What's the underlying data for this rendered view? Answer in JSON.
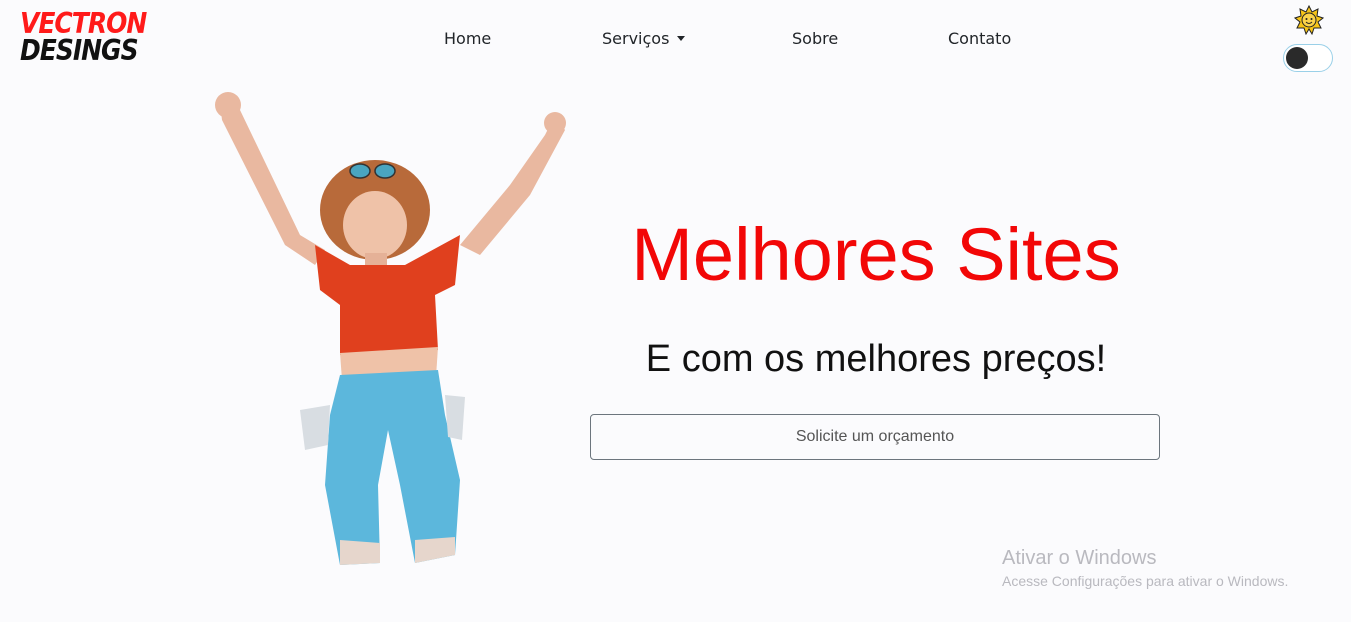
{
  "logo": {
    "line1": "VECTRON",
    "line2": "DESINGS"
  },
  "nav": {
    "home": "Home",
    "services": "Serviços",
    "about": "Sobre",
    "contact": "Contato"
  },
  "theme_toggle": {
    "icon": "sun-icon",
    "state": "off"
  },
  "hero": {
    "title": "Melhores Sites",
    "subtitle": "E com os melhores preços!",
    "cta_label": "Solicite um orçamento",
    "image": "woman-jumping-photo"
  },
  "watermark": {
    "title": "Ativar o Windows",
    "subtitle": "Acesse Configurações para ativar o Windows."
  },
  "colors": {
    "accent": "#f20707",
    "text": "#111111",
    "toggle_border": "#9ad0e8"
  }
}
